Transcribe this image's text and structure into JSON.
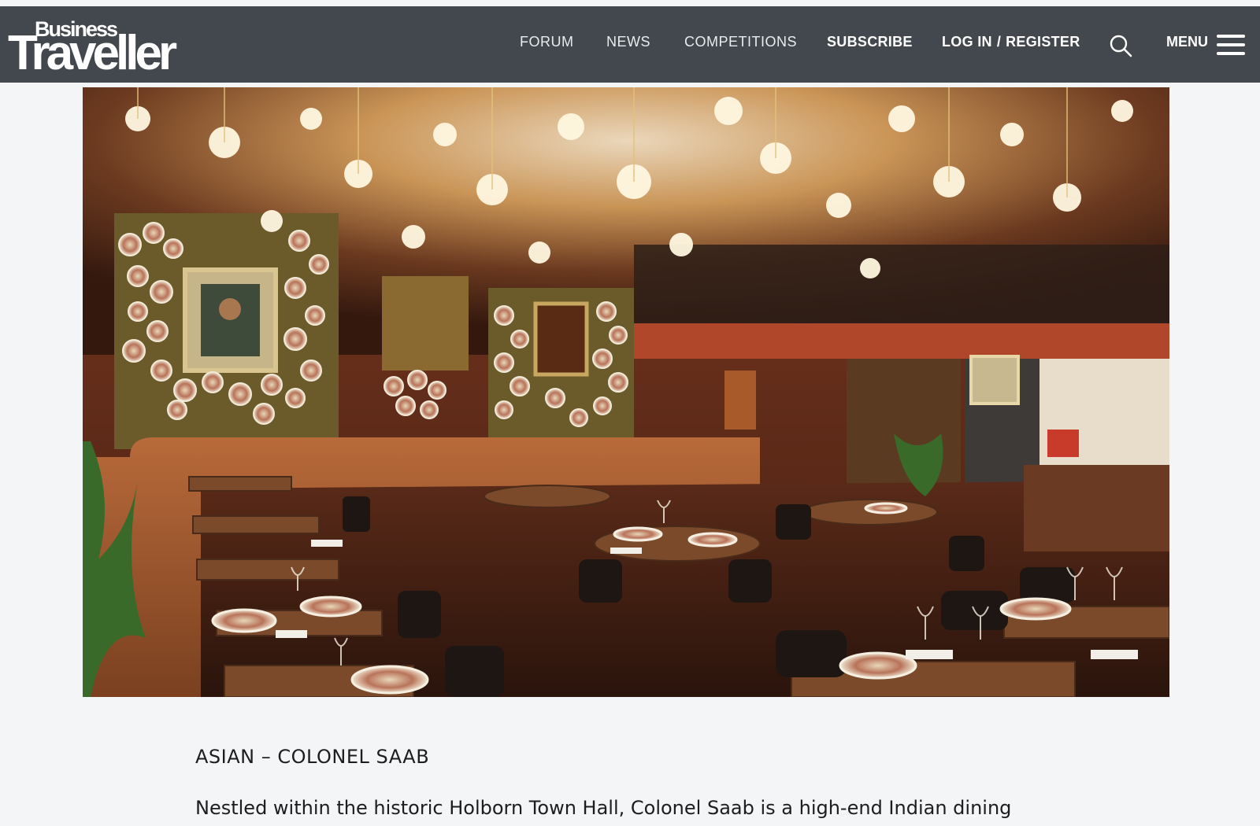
{
  "header": {
    "logo_top": "Business",
    "logo_bottom": "Traveller",
    "nav": [
      "FORUM",
      "NEWS",
      "COMPETITIONS"
    ],
    "subscribe": "SUBSCRIBE",
    "login": "LOG IN",
    "separator": "/",
    "register": "REGISTER",
    "menu": "MENU",
    "search_icon": "search-icon",
    "menu_icon": "hamburger-icon"
  },
  "article": {
    "kicker": "ASIAN – COLONEL SAAB",
    "lede": "Nestled within the historic Holborn Town Hall, Colonel Saab is a high-end Indian dining"
  },
  "colors": {
    "navbar": "#42484d",
    "page_background": "#f4f5f7"
  }
}
